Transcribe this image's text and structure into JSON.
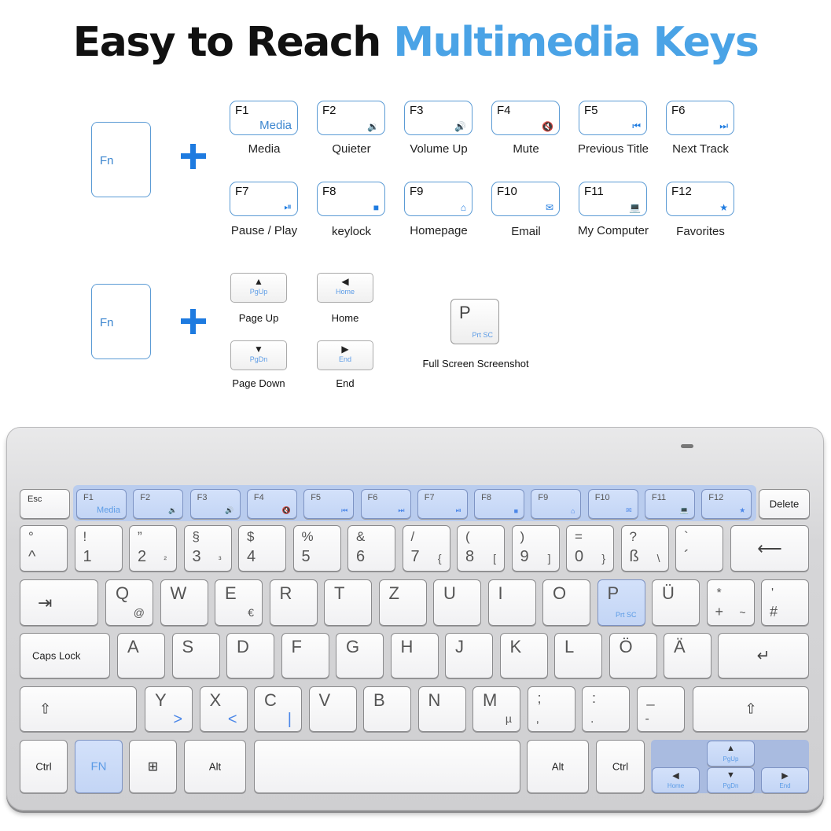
{
  "title": {
    "main": "Easy to Reach ",
    "accent": "Multimedia Keys"
  },
  "colors": {
    "accent": "#4aa3e6",
    "key_blue": "#c3d5f5",
    "plus": "#1e7be0"
  },
  "fn_label": "Fn",
  "fkeys": [
    {
      "key": "F1",
      "icon": "Media",
      "icon_name": "media-text",
      "label": "Media"
    },
    {
      "key": "F2",
      "icon": "🔉",
      "icon_name": "volume-down-icon",
      "label": "Quieter"
    },
    {
      "key": "F3",
      "icon": "🔊",
      "icon_name": "volume-up-icon",
      "label": "Volume Up"
    },
    {
      "key": "F4",
      "icon": "🔇",
      "icon_name": "mute-icon",
      "label": "Mute"
    },
    {
      "key": "F5",
      "icon": "⏮",
      "icon_name": "previous-track-icon",
      "label": "Previous Title"
    },
    {
      "key": "F6",
      "icon": "⏭",
      "icon_name": "next-track-icon",
      "label": "Next Track"
    },
    {
      "key": "F7",
      "icon": "⏯",
      "icon_name": "play-pause-icon",
      "label": "Pause / Play"
    },
    {
      "key": "F8",
      "icon": "■",
      "icon_name": "stop-square-icon",
      "label": "keylock"
    },
    {
      "key": "F9",
      "icon": "⌂",
      "icon_name": "home-icon",
      "label": "Homepage"
    },
    {
      "key": "F10",
      "icon": "✉",
      "icon_name": "email-icon",
      "label": "Email"
    },
    {
      "key": "F11",
      "icon": "💻",
      "icon_name": "computer-icon",
      "label": "My Computer"
    },
    {
      "key": "F12",
      "icon": "★",
      "icon_name": "favorites-folder-icon",
      "label": "Favorites"
    }
  ],
  "nav": [
    {
      "arrow": "▲",
      "text": "PgUp",
      "label": "Page Up"
    },
    {
      "arrow": "◀",
      "text": "Home",
      "label": "Home"
    },
    {
      "arrow": "▼",
      "text": "PgDn",
      "label": "Page Down"
    },
    {
      "arrow": "▶",
      "text": "End",
      "label": "End"
    }
  ],
  "prtsc": {
    "letter": "P",
    "text": "Prt SC",
    "label": "Full Screen Screenshot"
  },
  "keyboard": {
    "esc": "Esc",
    "delete": "Delete",
    "row1": [
      {
        "top": "°",
        "bottom": "^"
      },
      {
        "top": "!",
        "bottom": "1"
      },
      {
        "top": "”",
        "bottom": "2",
        "alt": "²"
      },
      {
        "top": "§",
        "bottom": "3",
        "alt": "³"
      },
      {
        "top": "$",
        "bottom": "4"
      },
      {
        "top": "%",
        "bottom": "5"
      },
      {
        "top": "&",
        "bottom": "6"
      },
      {
        "top": "/",
        "bottom": "7",
        "alt": "{"
      },
      {
        "top": "(",
        "bottom": "8",
        "alt": "["
      },
      {
        "top": ")",
        "bottom": "9",
        "alt": "]"
      },
      {
        "top": "=",
        "bottom": "0",
        "alt": "}"
      },
      {
        "top": "?",
        "bottom": "ß",
        "alt": "\\"
      },
      {
        "top": "`",
        "bottom": "´"
      }
    ],
    "backspace": "⟵",
    "tab": "⇥",
    "row2": [
      {
        "top": "Q",
        "alt": "@"
      },
      {
        "top": "W"
      },
      {
        "top": "E",
        "alt": "€"
      },
      {
        "top": "R"
      },
      {
        "top": "T"
      },
      {
        "top": "Z"
      },
      {
        "top": "U"
      },
      {
        "top": "I"
      },
      {
        "top": "O"
      },
      {
        "top": "P",
        "alt": "Prt SC"
      },
      {
        "top": "Ü"
      },
      {
        "top": "*",
        "bottom": "+",
        "alt": "~"
      },
      {
        "top": "'",
        "bottom": "#"
      }
    ],
    "caps": "Caps Lock",
    "row3": [
      "A",
      "S",
      "D",
      "F",
      "G",
      "H",
      "J",
      "K",
      "L",
      "Ö",
      "Ä"
    ],
    "enter": "↵",
    "shift": "⇧",
    "row4": [
      {
        "top": "Y",
        "alt": ">"
      },
      {
        "top": "X",
        "alt": "<"
      },
      {
        "top": "C",
        "alt": "|"
      },
      {
        "top": "V"
      },
      {
        "top": "B"
      },
      {
        "top": "N"
      },
      {
        "top": "M",
        "alt": "µ"
      },
      {
        "top": ";",
        "bottom": ","
      },
      {
        "top": ":",
        "bottom": "."
      },
      {
        "top": "_",
        "bottom": "-"
      }
    ],
    "ctrl": "Ctrl",
    "fn": "FN",
    "win": "⊞",
    "alt": "Alt"
  }
}
